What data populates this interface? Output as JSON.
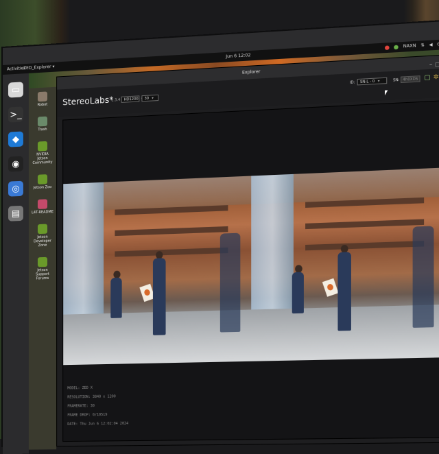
{
  "topbar": {
    "activities": "Activities",
    "app_menu": "ZED_Explorer ▾",
    "clock": "Jun 6  12:02",
    "tray_items": [
      "NAXN"
    ]
  },
  "window": {
    "title": "Explorer"
  },
  "app": {
    "brand": "StereoLabs*",
    "version": "1.3.4",
    "resolution": "HD1200",
    "framerate": "30",
    "id_label": "ID:",
    "id_value": "SN:L - 0",
    "sn_label": "SN:",
    "sn_value": "4h0XDS"
  },
  "desktop": {
    "items": [
      {
        "label": "Robot",
        "icon": "home-folder-icon",
        "color": "#8a7a6a"
      },
      {
        "label": "Trash",
        "icon": "trash-icon",
        "color": "#6a8a6a"
      },
      {
        "label": "NVIDIA Jetson Community",
        "icon": "nvidia-icon",
        "color": "#6a9a2a"
      },
      {
        "label": "Jetson Zoo",
        "icon": "nvidia-icon",
        "color": "#6a9a2a"
      },
      {
        "label": "L4T-README",
        "icon": "folder-icon",
        "color": "#c44a6a"
      },
      {
        "label": "Jetson Developer Zone",
        "icon": "nvidia-icon",
        "color": "#6a9a2a"
      },
      {
        "label": "Jetson Support Forums",
        "icon": "nvidia-icon",
        "color": "#6a9a2a"
      }
    ]
  },
  "dock": {
    "items": [
      {
        "name": "files-icon",
        "glyph": "▭",
        "color": "#d8d8d8"
      },
      {
        "name": "terminal-icon",
        "glyph": ">_",
        "color": "#333"
      },
      {
        "name": "vscode-icon",
        "glyph": "◆",
        "color": "#1e7ad6"
      },
      {
        "name": "obs-icon",
        "glyph": "◉",
        "color": "#222"
      },
      {
        "name": "chromium-icon",
        "glyph": "◎",
        "color": "#3a7ad6"
      },
      {
        "name": "drive-icon",
        "glyph": "▤",
        "color": "#777"
      }
    ]
  },
  "info": {
    "lines": [
      "MODEL: ZED X",
      "RESOLUTION: 3840 x 1200",
      "FRAMERATE: 30",
      "FRAME DROP: 0/10519",
      "DATE: Thu Jun 6 12:02:04 2024"
    ]
  }
}
